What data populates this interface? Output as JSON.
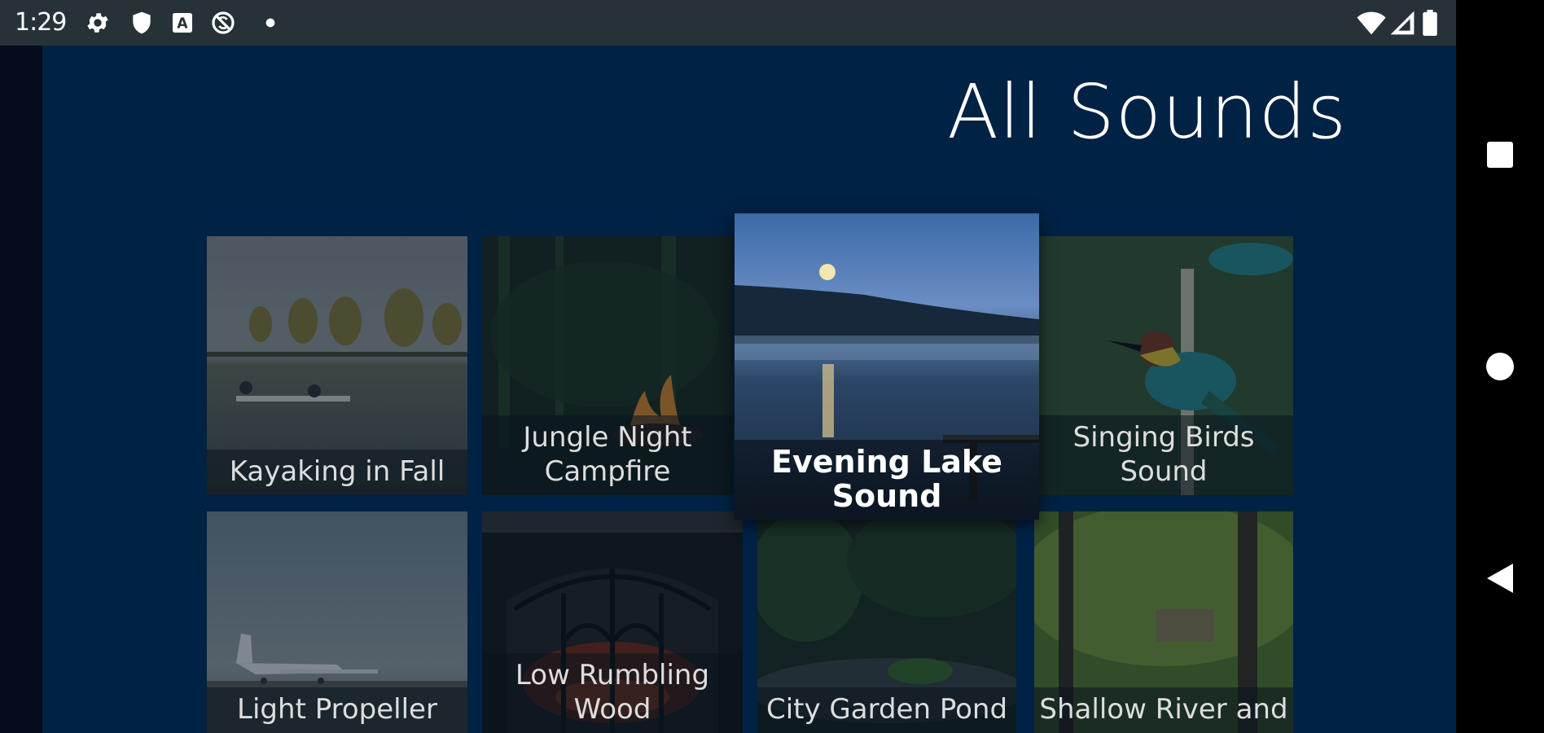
{
  "status": {
    "time": "1:29"
  },
  "page": {
    "title": "All Sounds"
  },
  "cards": [
    {
      "label": "Kayaking in Fall"
    },
    {
      "label": "Jungle Night\nCampfire"
    },
    {
      "label": "Evening Lake Sound"
    },
    {
      "label": "Singing Birds Sound"
    },
    {
      "label": "Light Propeller"
    },
    {
      "label": "Low Rumbling Wood"
    },
    {
      "label": "City Garden Pond"
    },
    {
      "label": "Shallow River and"
    }
  ],
  "icons": {
    "status": [
      "gear-icon",
      "shield-icon",
      "a-icon",
      "no-sync-icon",
      "dot-icon",
      "wifi-icon",
      "signal-icon",
      "battery-icon"
    ],
    "nav": [
      "recents-icon",
      "home-icon",
      "back-icon"
    ]
  },
  "colors": {
    "background": "#002244",
    "statusbar": "#263238",
    "navbar": "#000000"
  }
}
